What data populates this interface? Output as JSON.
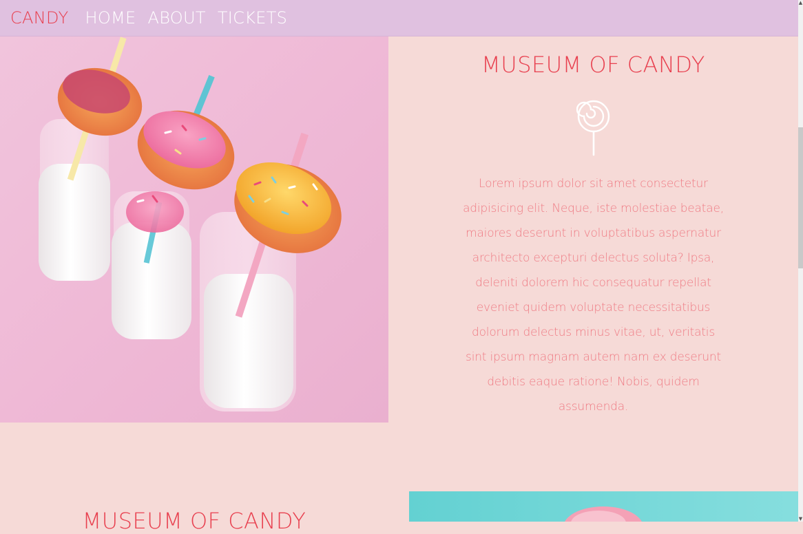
{
  "navbar": {
    "brand": "CANDY",
    "links": [
      "HOME",
      "ABOUT",
      "TICKETS"
    ]
  },
  "hero": {
    "image_alt": "Milk bottles with donuts and striped straws",
    "title": "MUSEUM OF CANDY",
    "icon": "lollipop-icon",
    "text": "Lorem ipsum dolor sit amet consectetur adipisicing elit. Neque, iste molestiae beatae, maiores deserunt in voluptatibus aspernatur architecto excepturi delectus soluta? Ipsa, deleniti dolorem hic consequatur repellat eveniet quidem voluptate necessitatibus dolorum delectus minus vitae, ut, veritatis sint ipsum magnam autem nam ex deserunt debitis eaque ratione! Nobis, quidem assumenda."
  },
  "section_two": {
    "title": "MUSEUM OF CANDY",
    "image_alt": "Cotton candy on teal background"
  },
  "colors": {
    "navbar_bg": "#e0c1e0",
    "page_bg": "#f6dad7",
    "accent_red": "#e8404f",
    "body_pink": "#ef7b84",
    "image_pink": "#f2bfd7",
    "teal": "#6fd6d6"
  }
}
